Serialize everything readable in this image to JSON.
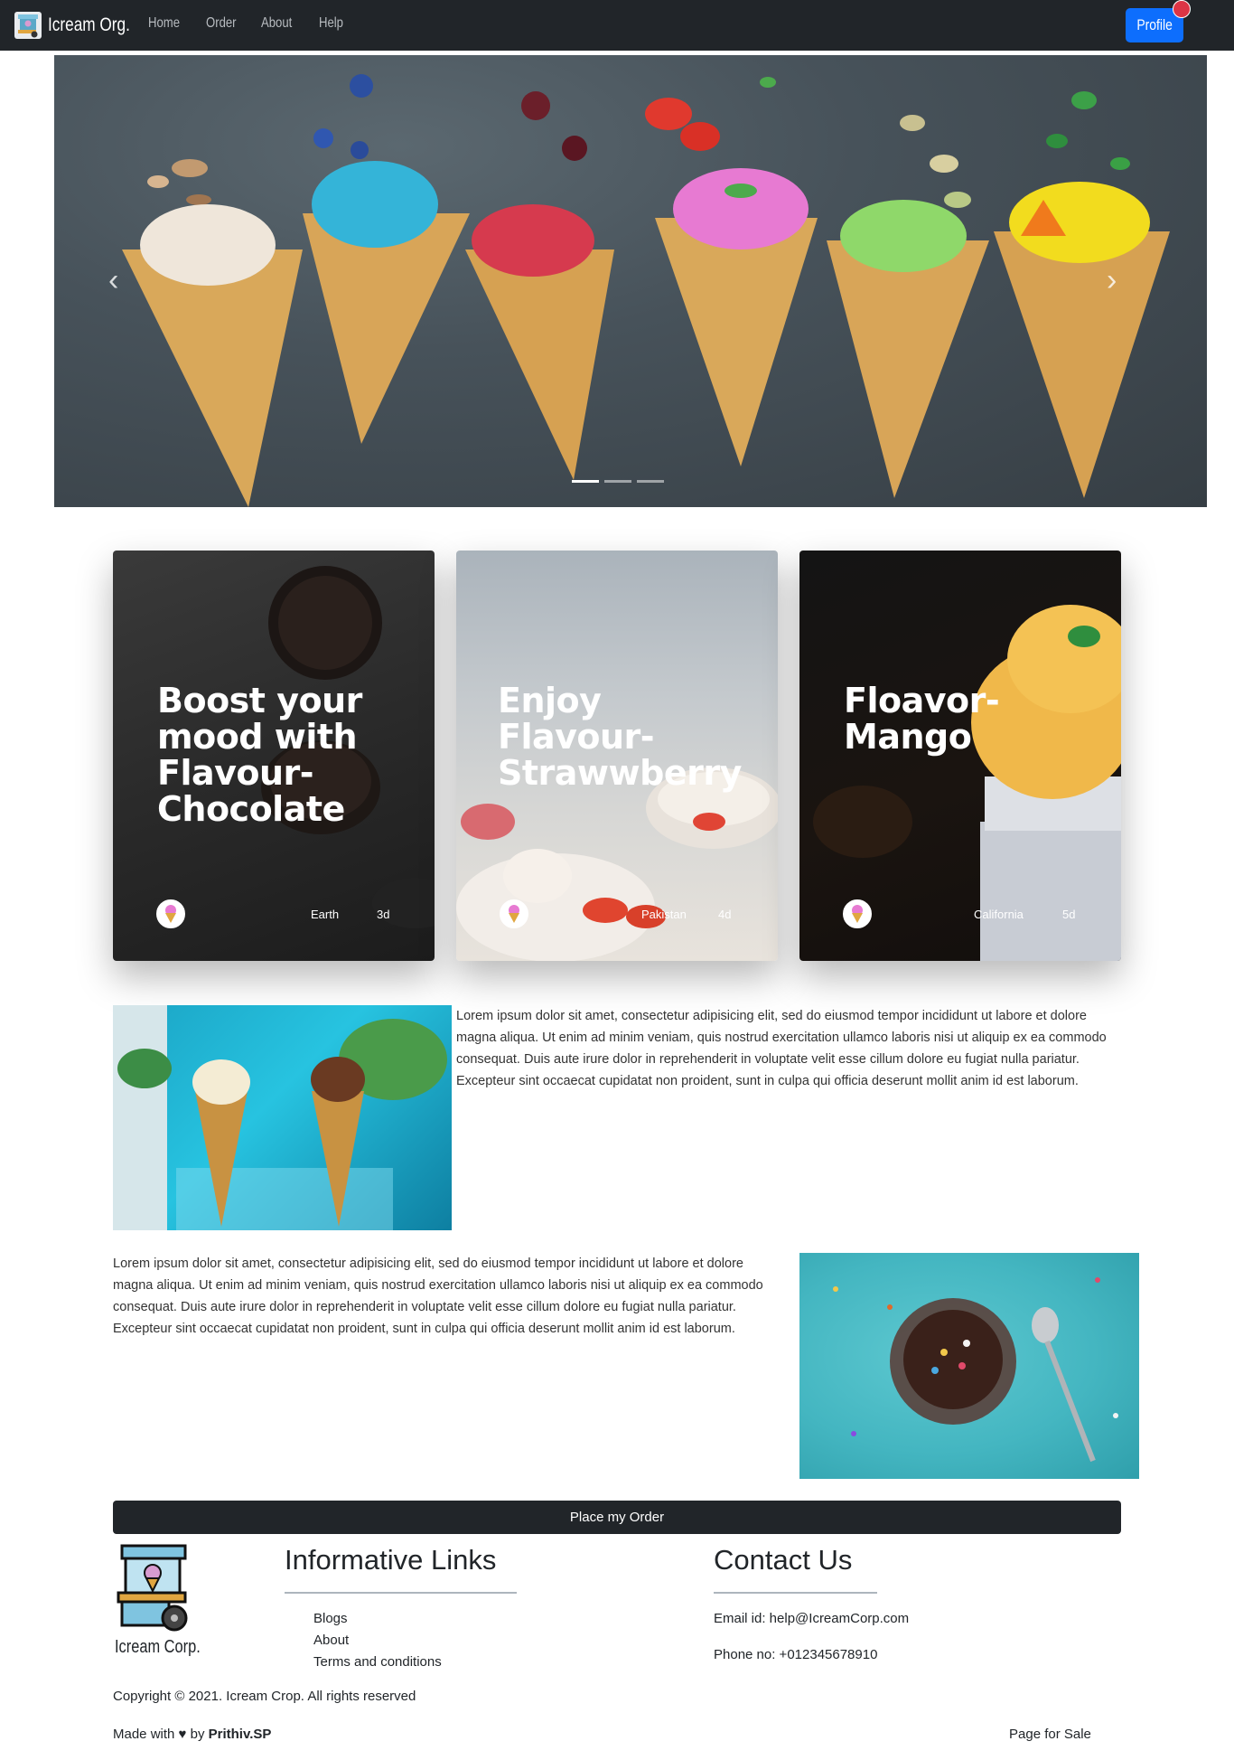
{
  "navbar": {
    "brand": "Icream Org.",
    "links": [
      "Home",
      "Order",
      "About",
      "Help"
    ],
    "profile_label": "Profile"
  },
  "hero": {
    "prev_icon": "chevron-left-icon",
    "next_icon": "chevron-right-icon",
    "slides": 3,
    "active_slide": 1
  },
  "cards": [
    {
      "title": "Boost your mood with Flavour-Chocolate",
      "location": "Earth",
      "time": "3d"
    },
    {
      "title": "Enjoy Flavour-Strawwberry",
      "location": "Pakistan",
      "time": "4d"
    },
    {
      "title": "Floavor-Mango",
      "location": "California",
      "time": "5d"
    }
  ],
  "content": {
    "paragraph1": "Lorem ipsum dolor sit amet, consectetur adipisicing elit, sed do eiusmod tempor incididunt ut labore et dolore magna aliqua. Ut enim ad minim veniam, quis nostrud exercitation ullamco laboris nisi ut aliquip ex ea commodo consequat. Duis aute irure dolor in reprehenderit in voluptate velit esse cillum dolore eu fugiat nulla pariatur. Excepteur sint occaecat cupidatat non proident, sunt in culpa qui officia deserunt mollit anim id est laborum.",
    "paragraph2": "Lorem ipsum dolor sit amet, consectetur adipisicing elit, sed do eiusmod tempor incididunt ut labore et dolore magna aliqua. Ut enim ad minim veniam, quis nostrud exercitation ullamco laboris nisi ut aliquip ex ea commodo consequat. Duis aute irure dolor in reprehenderit in voluptate velit esse cillum dolore eu fugiat nulla pariatur. Excepteur sint occaecat cupidatat non proident, sunt in culpa qui officia deserunt mollit anim id est laborum.",
    "order_button": "Place my Order"
  },
  "footer": {
    "brand": "Icream Corp.",
    "links_heading": "Informative Links",
    "links": [
      "Blogs",
      "About",
      "Terms and conditions"
    ],
    "contact_heading": "Contact Us",
    "email": "Email id: help@IcreamCorp.com",
    "phone": "Phone no: +012345678910",
    "copyright": "Copyright © 2021. Icream Crop. All rights reserved",
    "made_with_prefix": "Made with ♥ by ",
    "author": "Prithiv.SP",
    "sale": "Page for Sale"
  },
  "colors": {
    "navbar": "#212529",
    "primary": "#0d6efd",
    "badge": "#dc3545"
  }
}
